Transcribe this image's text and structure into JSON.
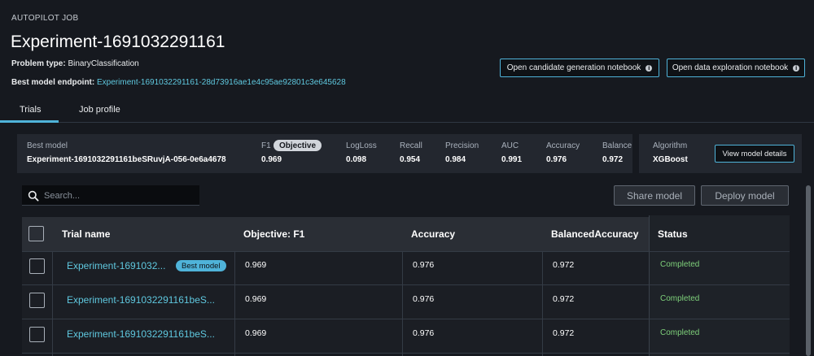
{
  "header": {
    "eyebrow": "AUTOPILOT JOB",
    "title": "Experiment-1691032291161",
    "problem_type_label": "Problem type:",
    "problem_type_value": "BinaryClassification",
    "endpoint_label": "Best model endpoint:",
    "endpoint_value": "Experiment-1691032291161-28d73916ae1e4c95ae92801c3e645628"
  },
  "notebook_buttons": {
    "candidate": "Open candidate generation notebook",
    "exploration": "Open data exploration notebook"
  },
  "tabs": [
    {
      "label": "Trials",
      "active": true
    },
    {
      "label": "Job profile",
      "active": false
    }
  ],
  "summary": {
    "best_model_label": "Best model",
    "best_model_value": "Experiment-1691032291161beSRuvjA-056-0e6a4678",
    "f1_label": "F1",
    "objective_badge": "Objective",
    "f1_value": "0.969",
    "logloss_label": "LogLoss",
    "logloss_value": "0.098",
    "recall_label": "Recall",
    "recall_value": "0.954",
    "precision_label": "Precision",
    "precision_value": "0.984",
    "auc_label": "AUC",
    "auc_value": "0.991",
    "accuracy_label": "Accuracy",
    "accuracy_value": "0.976",
    "balanced_label": "Balance",
    "balanced_value": "0.972",
    "algorithm_label": "Algorithm",
    "algorithm_value": "XGBoost",
    "view_details": "View model details"
  },
  "search": {
    "placeholder": "Search..."
  },
  "actions": {
    "share": "Share model",
    "deploy": "Deploy model"
  },
  "table": {
    "headers": {
      "trial_name": "Trial name",
      "objective": "Objective: F1",
      "accuracy": "Accuracy",
      "balanced": "BalancedAccuracy",
      "status": "Status"
    },
    "best_badge": "Best model",
    "rows": [
      {
        "name": "Experiment-1691032...",
        "f1": "0.969",
        "accuracy": "0.976",
        "balanced": "0.972",
        "status": "Completed"
      },
      {
        "name": "Experiment-1691032291161beS...",
        "f1": "0.969",
        "accuracy": "0.976",
        "balanced": "0.972",
        "status": "Completed"
      },
      {
        "name": "Experiment-1691032291161beS...",
        "f1": "0.969",
        "accuracy": "0.976",
        "balanced": "0.972",
        "status": "Completed"
      }
    ]
  },
  "colors": {
    "background": "#16191f",
    "accent": "#4fb3d9",
    "link": "#5fc8df",
    "success": "#7ed07a"
  }
}
